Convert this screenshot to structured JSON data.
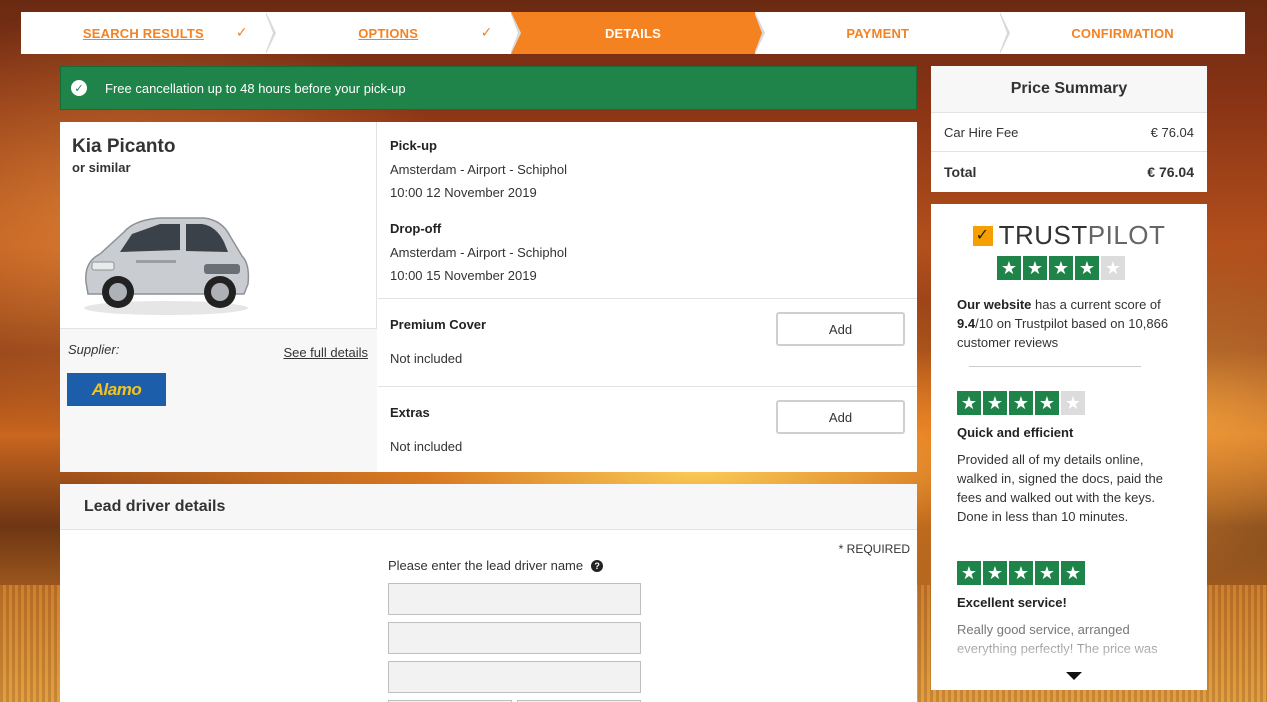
{
  "steps": [
    {
      "label": "SEARCH RESULTS",
      "state": "done"
    },
    {
      "label": "OPTIONS",
      "state": "done"
    },
    {
      "label": "DETAILS",
      "state": "active"
    },
    {
      "label": "PAYMENT",
      "state": "upcoming"
    },
    {
      "label": "CONFIRMATION",
      "state": "upcoming"
    }
  ],
  "banner": {
    "text": "Free cancellation up to 48 hours before your pick-up",
    "icon": "check-circle-icon"
  },
  "car": {
    "name": "Kia Picanto",
    "similar": "or similar",
    "supplier_label": "Supplier:",
    "see_details": "See full details",
    "supplier_logo": "Alamo"
  },
  "pickup": {
    "title": "Pick-up",
    "location": "Amsterdam - Airport - Schiphol",
    "datetime": "10:00 12 November 2019"
  },
  "dropoff": {
    "title": "Drop-off",
    "location": "Amsterdam - Airport - Schiphol",
    "datetime": "10:00 15 November 2019"
  },
  "premium": {
    "title": "Premium Cover",
    "status": "Not included",
    "button": "Add"
  },
  "extras": {
    "title": "Extras",
    "status": "Not included",
    "button": "Add"
  },
  "lead": {
    "title": "Lead driver details",
    "required": "* REQUIRED",
    "name_label": "Please enter the lead driver name"
  },
  "price": {
    "title": "Price Summary",
    "fee_label": "Car Hire Fee",
    "fee_value": "€ 76.04",
    "total_label": "Total",
    "total_value": "€ 76.04"
  },
  "trustpilot": {
    "brand_a": "TRUST",
    "brand_b": "PILOT",
    "rating_stars": 4,
    "score_bold1": "Our website",
    "score_text1": " has a current score of ",
    "score_bold2": "9.4",
    "score_text2": "/10 on Trustpilot based on 10,866 customer reviews",
    "reviews": [
      {
        "stars": 4,
        "title": "Quick and efficient",
        "text": "Provided all of my details online, walked in, signed the docs, paid the fees and walked out with the keys. Done in less than 10 minutes."
      },
      {
        "stars": 5,
        "title": "Excellent service!",
        "text": "Really good service, arranged everything perfectly! The price was"
      }
    ]
  },
  "colors": {
    "accent": "#f58220",
    "green": "#1e8449",
    "supplier_blue": "#1d5eaa"
  }
}
